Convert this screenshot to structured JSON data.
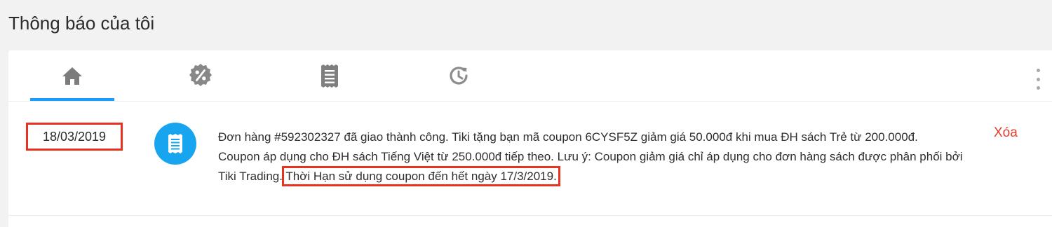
{
  "page": {
    "title": "Thông báo của tôi"
  },
  "tabs": [
    {
      "icon": "home-icon",
      "active": true
    },
    {
      "icon": "discount-icon",
      "active": false
    },
    {
      "icon": "order-receipt-icon",
      "active": false
    },
    {
      "icon": "history-icon",
      "active": false
    }
  ],
  "notification": {
    "date": "18/03/2019",
    "icon": "order-receipt-icon",
    "message": "Đơn hàng #592302327 đã giao thành công. Tiki tặng bạn mã coupon 6CYSF5Z giảm giá 50.000đ khi mua ĐH sách Trẻ từ 200.000đ. Coupon áp dụng cho ĐH sách Tiếng Việt từ 250.000đ tiếp theo. Lưu ý: Coupon giảm giá chỉ áp dụng cho đơn hàng sách được phân phối bởi Tiki Trading.",
    "expiry": "Thời Hạn sử dụng coupon đến hết ngày 17/3/2019.",
    "delete_label": "Xóa"
  },
  "colors": {
    "accent": "#189eff",
    "delete": "#e5392a",
    "highlight": "#e8321f"
  }
}
